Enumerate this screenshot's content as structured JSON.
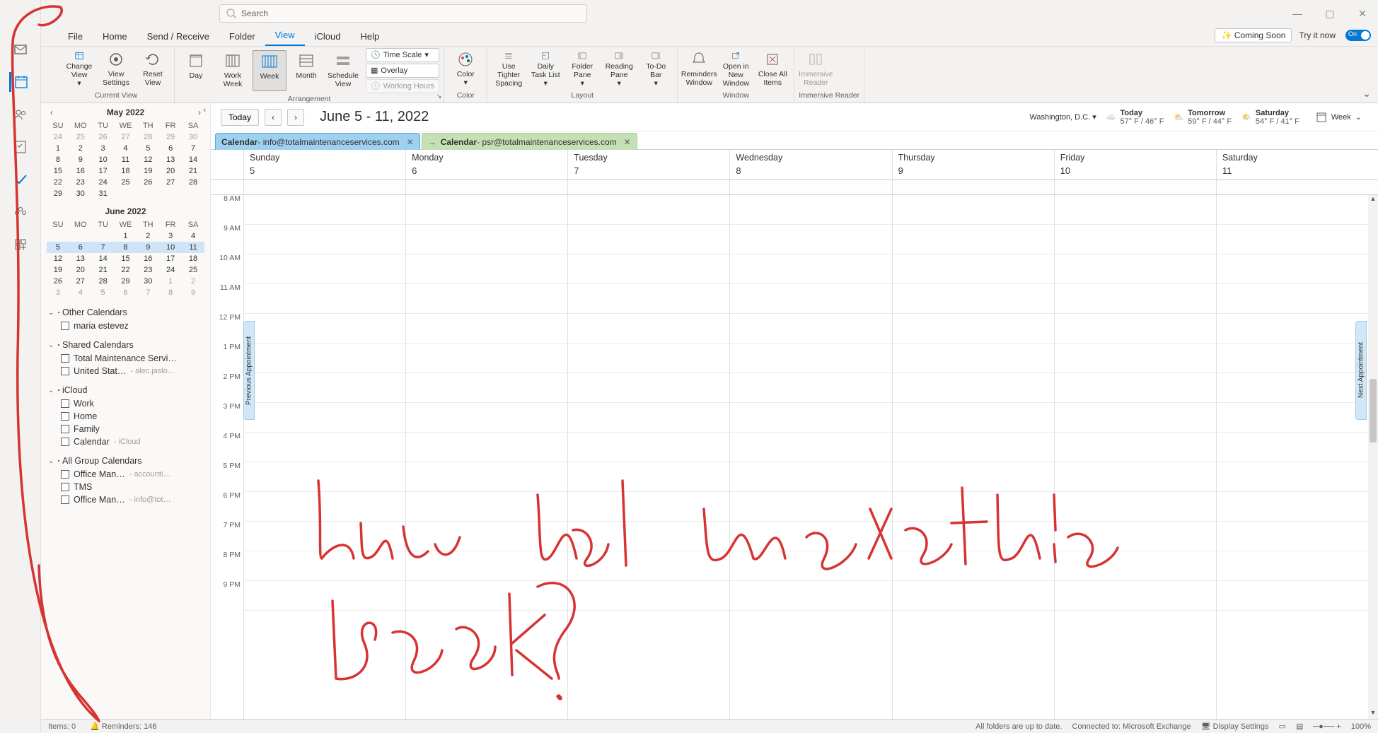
{
  "titlebar": {
    "search_placeholder": "Search"
  },
  "menu": {
    "tabs": [
      "File",
      "Home",
      "Send / Receive",
      "Folder",
      "View",
      "iCloud",
      "Help"
    ],
    "active": 4,
    "coming_soon": "Coming Soon",
    "try_it_now": "Try it now",
    "toggle_label": "On"
  },
  "ribbon": {
    "groups": [
      {
        "label": "Current View",
        "items": [
          "Change View",
          "View Settings",
          "Reset View"
        ]
      },
      {
        "label": "Arrangement",
        "items": [
          "Day",
          "Work Week",
          "Week",
          "Month",
          "Schedule View"
        ],
        "extras": {
          "time_scale": "Time Scale",
          "overlay": "Overlay",
          "working_hours": "Working Hours"
        },
        "active": 2
      },
      {
        "label": "Color",
        "items": [
          "Color"
        ]
      },
      {
        "label": "Layout",
        "items": [
          "Use Tighter Spacing",
          "Daily Task List",
          "Folder Pane",
          "Reading Pane",
          "To-Do Bar"
        ]
      },
      {
        "label": "Window",
        "items": [
          "Reminders Window",
          "Open in New Window",
          "Close All Items"
        ]
      },
      {
        "label": "Immersive Reader",
        "items": [
          "Immersive Reader"
        ],
        "disabled": true
      }
    ]
  },
  "minicals": [
    {
      "title": "May 2022",
      "dow": [
        "SU",
        "MO",
        "TU",
        "WE",
        "TH",
        "FR",
        "SA"
      ],
      "weeks": [
        [
          24,
          25,
          26,
          27,
          28,
          29,
          30
        ],
        [
          1,
          2,
          3,
          4,
          5,
          6,
          7
        ],
        [
          8,
          9,
          10,
          11,
          12,
          13,
          14
        ],
        [
          15,
          16,
          17,
          18,
          19,
          20,
          21
        ],
        [
          22,
          23,
          24,
          25,
          26,
          27,
          28
        ],
        [
          29,
          30,
          31,
          null,
          null,
          null,
          null
        ]
      ],
      "dim_first": 7,
      "dim_last": 0
    },
    {
      "title": "June 2022",
      "dow": [
        "SU",
        "MO",
        "TU",
        "WE",
        "TH",
        "FR",
        "SA"
      ],
      "weeks": [
        [
          null,
          null,
          null,
          1,
          2,
          3,
          4
        ],
        [
          5,
          6,
          7,
          8,
          9,
          10,
          11
        ],
        [
          12,
          13,
          14,
          15,
          16,
          17,
          18
        ],
        [
          19,
          20,
          21,
          22,
          23,
          24,
          25
        ],
        [
          26,
          27,
          28,
          29,
          30,
          1,
          2
        ],
        [
          3,
          4,
          5,
          6,
          7,
          8,
          9
        ]
      ],
      "dim_first": 0,
      "dim_last": 9,
      "sel_week": 1
    }
  ],
  "cal_groups": [
    {
      "name": "Other Calendars",
      "items": [
        {
          "label": "maria estevez"
        }
      ]
    },
    {
      "name": "Shared Calendars",
      "items": [
        {
          "label": "Total Maintenance Servi…"
        },
        {
          "label": "United Stat…",
          "sub": "- alec.jaslo…"
        }
      ]
    },
    {
      "name": "iCloud",
      "items": [
        {
          "label": "Work"
        },
        {
          "label": "Home"
        },
        {
          "label": "Family"
        },
        {
          "label": "Calendar",
          "sub": "- iCloud"
        }
      ]
    },
    {
      "name": "All Group Calendars",
      "items": [
        {
          "label": "Office Man…",
          "sub": "- accounti…"
        },
        {
          "label": "TMS"
        },
        {
          "label": "Office Man…",
          "sub": "- info@tot…"
        }
      ]
    }
  ],
  "cal_header": {
    "today": "Today",
    "range": "June 5 - 11, 2022",
    "location": "Washington, D.C.",
    "weather": [
      {
        "day": "Today",
        "temp": "57° F / 46° F"
      },
      {
        "day": "Tomorrow",
        "temp": "59° F / 44° F"
      },
      {
        "day": "Saturday",
        "temp": "54° F / 41° F"
      }
    ],
    "view_label": "Week"
  },
  "cal_tabs": [
    {
      "name": "Calendar",
      "account": "info@totalmaintenanceservices.com",
      "color": "blue"
    },
    {
      "name": "Calendar",
      "account": "psr@totalmaintenanceservices.com",
      "color": "green",
      "arrow": true
    }
  ],
  "days": [
    {
      "name": "Sunday",
      "num": "5"
    },
    {
      "name": "Monday",
      "num": "6"
    },
    {
      "name": "Tuesday",
      "num": "7"
    },
    {
      "name": "Wednesday",
      "num": "8"
    },
    {
      "name": "Thursday",
      "num": "9"
    },
    {
      "name": "Friday",
      "num": "10"
    },
    {
      "name": "Saturday",
      "num": "11"
    }
  ],
  "hours": [
    "8 AM",
    "9 AM",
    "10 AM",
    "11 AM",
    "12 PM",
    "1 PM",
    "2 PM",
    "3 PM",
    "4 PM",
    "5 PM",
    "6 PM",
    "7 PM",
    "8 PM",
    "9 PM"
  ],
  "appt_handles": {
    "prev": "Previous Appointment",
    "next": "Next Appointment"
  },
  "status": {
    "items_label": "Items: 0",
    "reminders_label": "Reminders: 146",
    "sync": "All folders are up to date.",
    "connected": "Connected to: Microsoft Exchange",
    "display": "Display Settings",
    "zoom": "100%"
  }
}
